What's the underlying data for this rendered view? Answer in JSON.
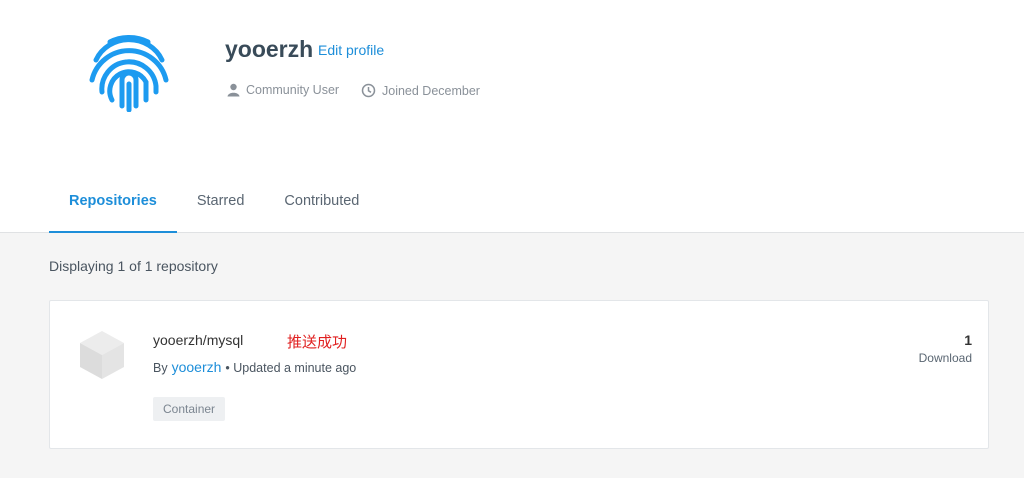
{
  "profile": {
    "username": "yooerzh",
    "edit_label": "Edit profile",
    "role": "Community User",
    "joined": "Joined December",
    "avatar_color": "#1d9bf0"
  },
  "tabs": [
    {
      "label": "Repositories",
      "active": true
    },
    {
      "label": "Starred",
      "active": false
    },
    {
      "label": "Contributed",
      "active": false
    }
  ],
  "repositories": {
    "count_text": "Displaying 1 of 1 repository",
    "items": [
      {
        "name": "yooerzh/mysql",
        "note": "推送成功",
        "by_label": "By",
        "owner": "yooerzh",
        "updated": "• Updated a minute ago",
        "badge": "Container",
        "downloads": "1",
        "downloads_label": "Download"
      }
    ]
  }
}
